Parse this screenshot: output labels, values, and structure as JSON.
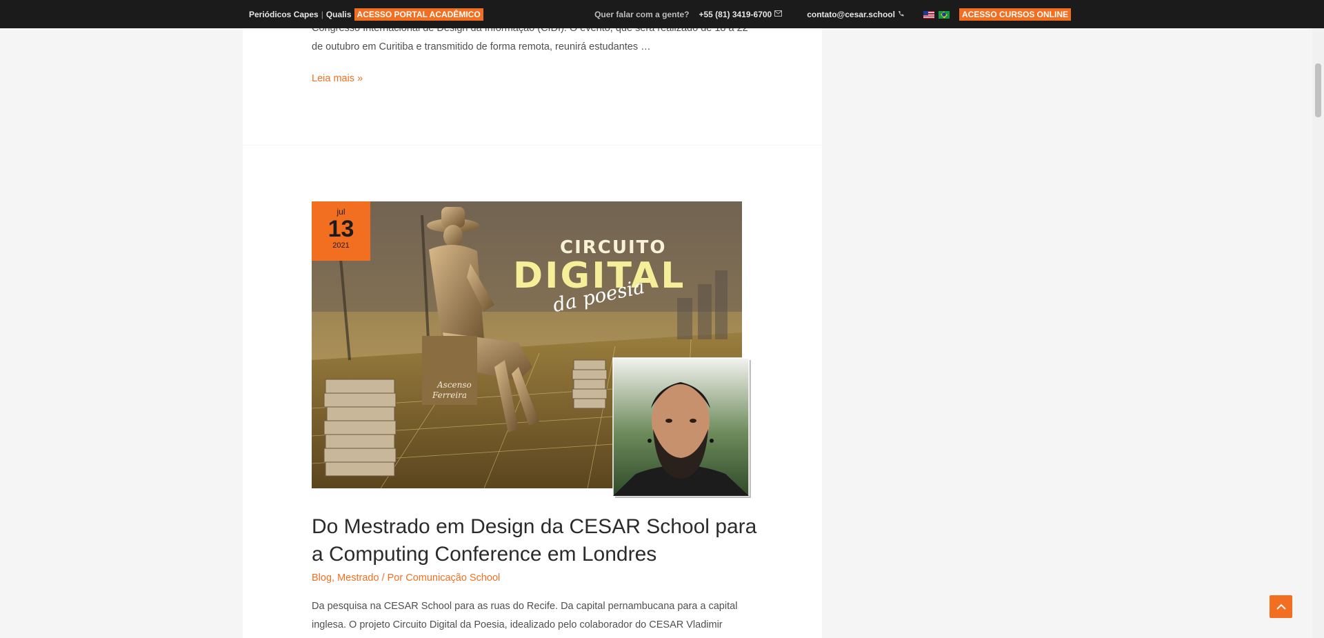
{
  "topbar": {
    "periodicos": "Periódicos Capes",
    "separator": "|",
    "qualis": "Qualis",
    "portal_tag": "ACESSO PORTAL ACADÊMICO",
    "contact_prompt": "Quer falar com a gente?",
    "phone": "+55 (81) 3419-6700",
    "email": "contato@cesar.school",
    "courses_tag": "ACESSO CURSOS ONLINE",
    "phone_icon": "envelope-icon",
    "email_icon": "phone-icon"
  },
  "previous_post": {
    "excerpt": "Congresso Internacional de Design da Informação (CIDI). O evento, que será realizado de 18 a 22 de outubro em Curitiba e transmitido de forma remota, reunirá estudantes …",
    "read_more": "Leia mais »"
  },
  "post": {
    "date": {
      "month": "jul",
      "day": "13",
      "year": "2021"
    },
    "image_text": {
      "line1": "CIRCUITO",
      "line2": "DIGITAL",
      "line3": "da poesia",
      "statue_label_1": "Ascenso",
      "statue_label_2": "Ferreira"
    },
    "title": "Do Mestrado em Design da CESAR School para a Computing Conference em Londres",
    "meta": {
      "category1": "Blog",
      "category2": "Mestrado",
      "by": "/ Por",
      "author": "Comunicação School"
    },
    "excerpt": "Da pesquisa na CESAR School para as ruas do Recife. Da capital pernambucana para a capital inglesa. O projeto Circuito Digital da Poesia, idealizado pelo colaborador do CESAR Vladimir"
  },
  "colors": {
    "accent": "#f26f21",
    "topbar": "#1b1b1b",
    "page_bg": "#f5f5f5"
  }
}
